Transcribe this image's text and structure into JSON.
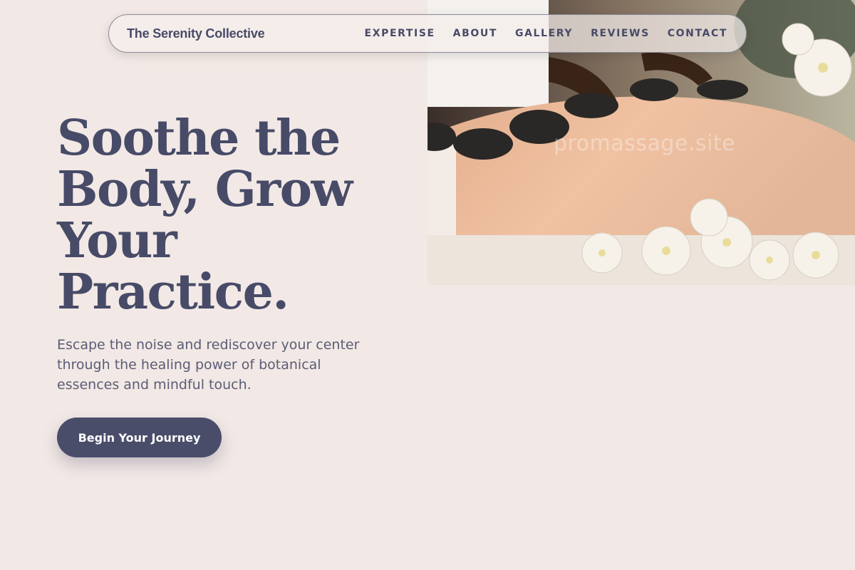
{
  "brand": {
    "name": "The Serenity Collective"
  },
  "nav": {
    "items": [
      {
        "label": "EXPERTISE"
      },
      {
        "label": "ABOUT"
      },
      {
        "label": "GALLERY"
      },
      {
        "label": "REVIEWS"
      },
      {
        "label": "CONTACT"
      }
    ]
  },
  "hero": {
    "headline_lines": [
      "Soothe the",
      "Body, Grow",
      "Your",
      "Practice."
    ],
    "subtitle": "Escape the noise and rediscover your center through the healing power of botanical essences and mindful touch.",
    "cta_label": "Begin Your Journey",
    "watermark": "promassage.site"
  },
  "colors": {
    "background": "#f2e8e5",
    "primary": "#4a4d6a",
    "text": "#474b68"
  }
}
